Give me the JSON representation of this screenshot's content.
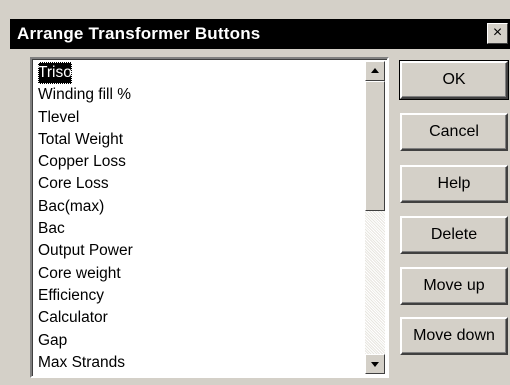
{
  "dialog": {
    "title": "Arrange Transformer Buttons",
    "close_label": "×"
  },
  "list": {
    "items": [
      {
        "label": "Triso",
        "selected": true
      },
      {
        "label": "Winding fill %"
      },
      {
        "label": "Tlevel"
      },
      {
        "label": "Total Weight"
      },
      {
        "label": "Copper Loss"
      },
      {
        "label": "Core Loss"
      },
      {
        "label": "Bac(max)"
      },
      {
        "label": "Bac"
      },
      {
        "label": "Output Power"
      },
      {
        "label": "Core weight"
      },
      {
        "label": "Efficiency"
      },
      {
        "label": "Calculator"
      },
      {
        "label": "Gap"
      },
      {
        "label": "Max Strands"
      }
    ]
  },
  "buttons": {
    "ok": "OK",
    "cancel": "Cancel",
    "help": "Help",
    "delete": "Delete",
    "move_up": "Move up",
    "move_down": "Move down"
  },
  "icons": {
    "scroll_up": "chevron-up-icon",
    "scroll_down": "chevron-down-icon",
    "close": "close-icon"
  },
  "colors": {
    "face": "#d4d0c8",
    "titlebar": "#000000",
    "selection": "#000000"
  }
}
